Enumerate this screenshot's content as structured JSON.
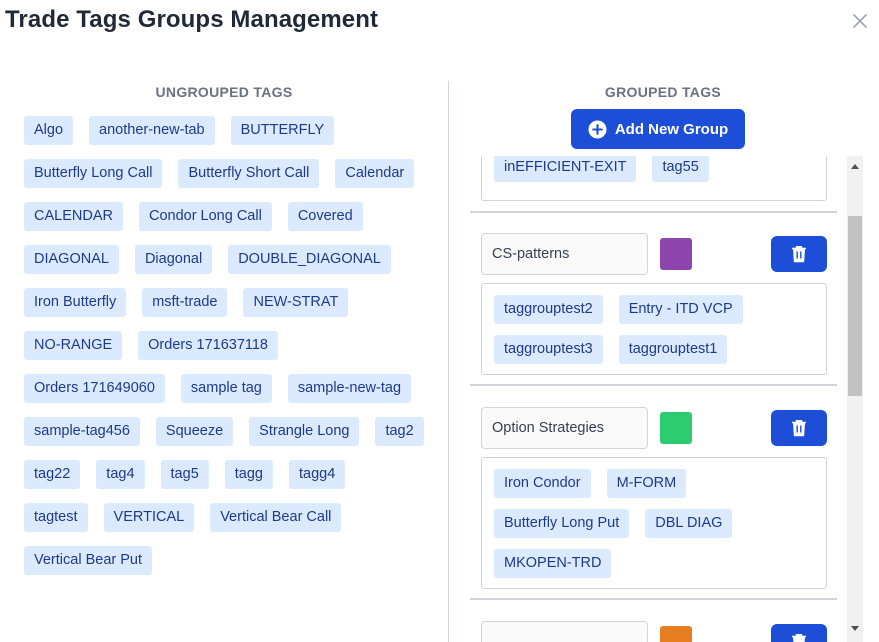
{
  "dialog": {
    "title": "Trade Tags Groups Management",
    "close_icon": "close-icon"
  },
  "ungrouped": {
    "heading": "UNGROUPED TAGS",
    "tags": [
      "Algo",
      "another-new-tab",
      "BUTTERFLY",
      "Butterfly Long Call",
      "Butterfly Short Call",
      "Calendar",
      "CALENDAR",
      "Condor Long Call",
      "Covered",
      "DIAGONAL",
      "Diagonal",
      "DOUBLE_DIAGONAL",
      "Iron Butterfly",
      "msft-trade",
      "NEW-STRAT",
      "NO-RANGE",
      "Orders 171637118",
      "Orders 171649060",
      "sample tag",
      "sample-new-tag",
      "sample-tag456",
      "Squeeze",
      "Strangle Long",
      "tag2",
      "tag22",
      "tag4",
      "tag5",
      "tagg",
      "tagg4",
      "tagtest",
      "VERTICAL",
      "Vertical Bear Call",
      "Vertical Bear Put"
    ]
  },
  "grouped": {
    "heading": "GROUPED TAGS",
    "add_button_label": "Add New Group",
    "add_button_icon": "plus-circle-icon",
    "partial_group": {
      "tags": [
        "inEFFICIENT-EXIT",
        "tag55"
      ]
    },
    "groups": [
      {
        "name": "CS-patterns",
        "color": "#8e44ad",
        "tags": [
          "taggrouptest2",
          "Entry - ITD VCP",
          "taggrouptest3",
          "taggrouptest1"
        ]
      },
      {
        "name": "Option Strategies",
        "color": "#2ecc71",
        "tags": [
          "Iron Condor",
          "M-FORM",
          "Butterfly Long Put",
          "DBL DIAG",
          "MKOPEN-TRD"
        ]
      },
      {
        "name": "",
        "color": "#e67e22",
        "tags": []
      }
    ],
    "delete_icon": "trash-icon"
  },
  "colors": {
    "primary": "#1d4ed8",
    "tag_bg": "#dbeafe",
    "tag_text": "#1e3a8a"
  }
}
